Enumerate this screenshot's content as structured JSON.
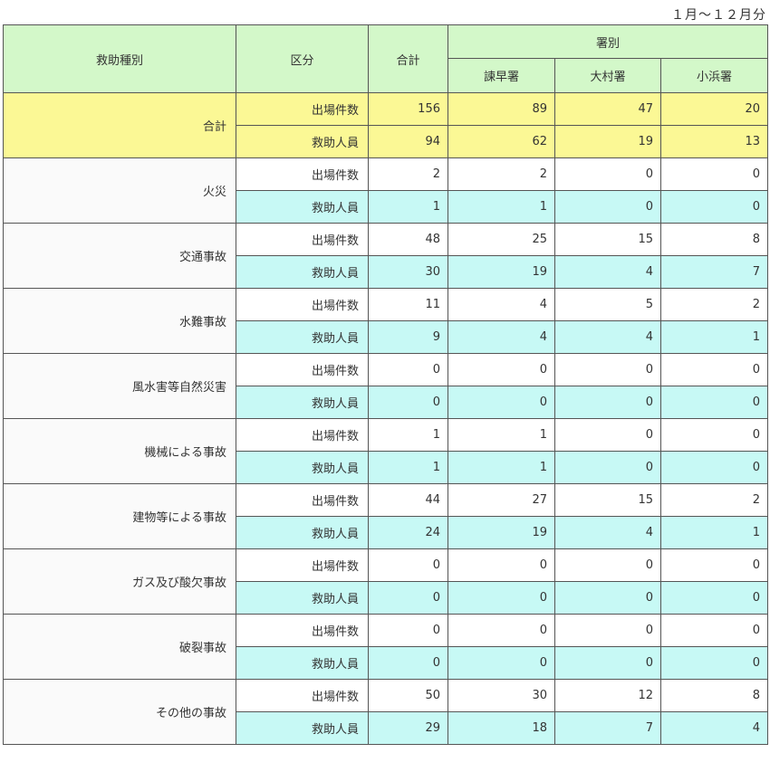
{
  "period_label": "１月～１２月分",
  "headers": {
    "category": "救助種別",
    "kubun": "区分",
    "total": "合計",
    "stations_group": "署別",
    "stations": [
      "諫早署",
      "大村署",
      "小浜署"
    ]
  },
  "rows": [
    {
      "category": "合計",
      "is_total": true,
      "dispatch": {
        "label": "出場件数",
        "total": "156",
        "stations": [
          "89",
          "47",
          "20"
        ]
      },
      "rescue": {
        "label": "救助人員",
        "total": "94",
        "stations": [
          "62",
          "19",
          "13"
        ]
      }
    },
    {
      "category": "火災",
      "dispatch": {
        "label": "出場件数",
        "total": "2",
        "stations": [
          "2",
          "0",
          "0"
        ]
      },
      "rescue": {
        "label": "救助人員",
        "total": "1",
        "stations": [
          "1",
          "0",
          "0"
        ]
      }
    },
    {
      "category": "交通事故",
      "dispatch": {
        "label": "出場件数",
        "total": "48",
        "stations": [
          "25",
          "15",
          "8"
        ]
      },
      "rescue": {
        "label": "救助人員",
        "total": "30",
        "stations": [
          "19",
          "4",
          "7"
        ]
      }
    },
    {
      "category": "水難事故",
      "dispatch": {
        "label": "出場件数",
        "total": "11",
        "stations": [
          "4",
          "5",
          "2"
        ]
      },
      "rescue": {
        "label": "救助人員",
        "total": "9",
        "stations": [
          "4",
          "4",
          "1"
        ]
      }
    },
    {
      "category": "風水害等自然災害",
      "dispatch": {
        "label": "出場件数",
        "total": "0",
        "stations": [
          "0",
          "0",
          "0"
        ]
      },
      "rescue": {
        "label": "救助人員",
        "total": "0",
        "stations": [
          "0",
          "0",
          "0"
        ]
      }
    },
    {
      "category": "機械による事故",
      "dispatch": {
        "label": "出場件数",
        "total": "1",
        "stations": [
          "1",
          "0",
          "0"
        ]
      },
      "rescue": {
        "label": "救助人員",
        "total": "1",
        "stations": [
          "1",
          "0",
          "0"
        ]
      }
    },
    {
      "category": "建物等による事故",
      "dispatch": {
        "label": "出場件数",
        "total": "44",
        "stations": [
          "27",
          "15",
          "2"
        ]
      },
      "rescue": {
        "label": "救助人員",
        "total": "24",
        "stations": [
          "19",
          "4",
          "1"
        ]
      }
    },
    {
      "category": "ガス及び酸欠事故",
      "dispatch": {
        "label": "出場件数",
        "total": "0",
        "stations": [
          "0",
          "0",
          "0"
        ]
      },
      "rescue": {
        "label": "救助人員",
        "total": "0",
        "stations": [
          "0",
          "0",
          "0"
        ]
      }
    },
    {
      "category": "破裂事故",
      "dispatch": {
        "label": "出場件数",
        "total": "0",
        "stations": [
          "0",
          "0",
          "0"
        ]
      },
      "rescue": {
        "label": "救助人員",
        "total": "0",
        "stations": [
          "0",
          "0",
          "0"
        ]
      }
    },
    {
      "category": "その他の事故",
      "dispatch": {
        "label": "出場件数",
        "total": "50",
        "stations": [
          "30",
          "12",
          "8"
        ]
      },
      "rescue": {
        "label": "救助人員",
        "total": "29",
        "stations": [
          "18",
          "7",
          "4"
        ]
      }
    }
  ],
  "colors": {
    "header_bg": "#d3f8c9",
    "total_row_bg": "#fbf895",
    "rescue_row_bg": "#c7f9f5",
    "border": "#555555"
  }
}
